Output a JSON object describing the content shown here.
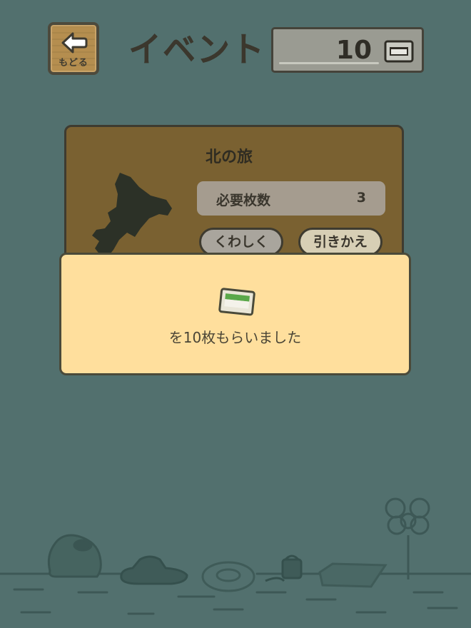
{
  "header": {
    "back_label": "もどる",
    "title": "イベント",
    "ticket_count": "10"
  },
  "event": {
    "title": "北の旅",
    "required_label": "必要枚数",
    "required_value": "3",
    "details_button": "くわしく",
    "exchange_button": "引きかえ"
  },
  "dialog": {
    "message": "を10枚もらいました"
  },
  "colors": {
    "background": "#52706e",
    "card": "#7a6131",
    "dialog": "#ffdf9d",
    "ticket_green": "#5aa84a"
  }
}
